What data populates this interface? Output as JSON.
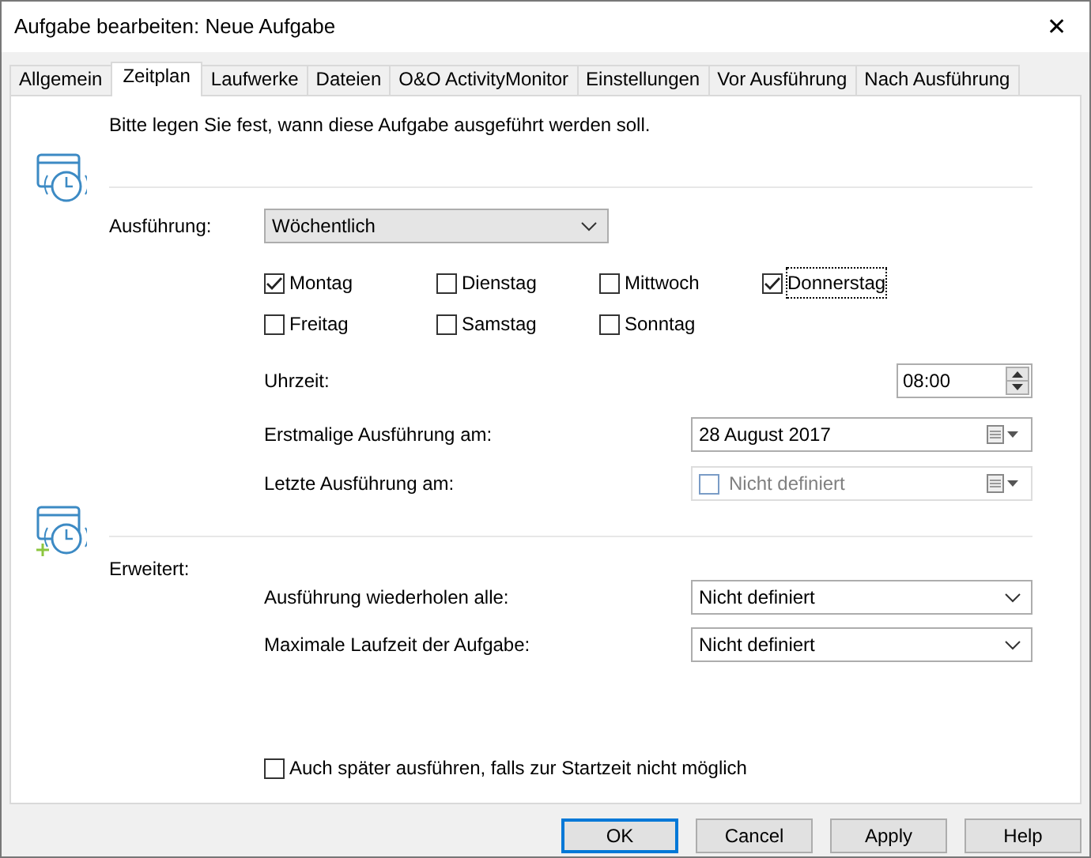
{
  "window": {
    "title": "Aufgabe bearbeiten: Neue Aufgabe",
    "close": "✕"
  },
  "tabs": [
    {
      "label": "Allgemein",
      "selected": false
    },
    {
      "label": "Zeitplan",
      "selected": true
    },
    {
      "label": "Laufwerke",
      "selected": false
    },
    {
      "label": "Dateien",
      "selected": false
    },
    {
      "label": "O&O ActivityMonitor",
      "selected": false
    },
    {
      "label": "Einstellungen",
      "selected": false
    },
    {
      "label": "Vor Ausführung",
      "selected": false
    },
    {
      "label": "Nach Ausführung",
      "selected": false
    }
  ],
  "intro": "Bitte legen Sie fest, wann diese Aufgabe ausgeführt werden soll.",
  "schedule": {
    "label": "Ausführung:",
    "value": "Wöchentlich"
  },
  "days": [
    {
      "label": "Montag",
      "checked": true,
      "focused": false
    },
    {
      "label": "Dienstag",
      "checked": false,
      "focused": false
    },
    {
      "label": "Mittwoch",
      "checked": false,
      "focused": false
    },
    {
      "label": "Donnerstag",
      "checked": true,
      "focused": true
    },
    {
      "label": "Freitag",
      "checked": false,
      "focused": false
    },
    {
      "label": "Samstag",
      "checked": false,
      "focused": false
    },
    {
      "label": "Sonntag",
      "checked": false,
      "focused": false
    }
  ],
  "time": {
    "label": "Uhrzeit:",
    "value": "08:00"
  },
  "first_run": {
    "label": "Erstmalige Ausführung am:",
    "value": "28 August 2017",
    "disabled": false
  },
  "last_run": {
    "label": "Letzte Ausführung am:",
    "value": "Nicht definiert",
    "disabled": true,
    "checked": false
  },
  "advanced": {
    "label": "Erweitert:",
    "fields": [
      {
        "label": "Ausführung wiederholen alle:",
        "value": "Nicht definiert"
      },
      {
        "label": "Maximale Laufzeit der Aufgabe:",
        "value": "Nicht definiert"
      }
    ]
  },
  "run_later": {
    "label": "Auch später ausführen, falls zur Startzeit nicht möglich",
    "checked": false
  },
  "buttons": [
    {
      "label": "OK",
      "default": true
    },
    {
      "label": "Cancel",
      "default": false
    },
    {
      "label": "Apply",
      "default": false
    },
    {
      "label": "Help",
      "default": false
    }
  ]
}
